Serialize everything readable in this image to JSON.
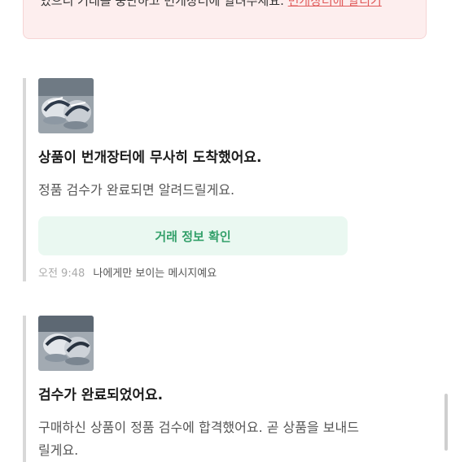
{
  "notice": {
    "text": "있으니 거래를 중단하고 번개장터에 알려주세요.",
    "link_label": "번개장터에 알리기"
  },
  "messages": [
    {
      "title": "상품이 번개장터에 무사히 도착했어요.",
      "body": "정품 검수가 완료되면 알려드릴게요.",
      "button_label": "거래 정보 확인",
      "time": "오전 9:48",
      "note": "나에게만 보이는 메시지예요"
    },
    {
      "title": "검수가 완료되었어요.",
      "body": "구매하신 상품이 정품 검수에 합격했어요. 곧 상품을 보내드릴게요."
    }
  ],
  "colors": {
    "notice_bg": "#fdeeee",
    "link": "#e05a5a",
    "button_bg": "#eaf8f1",
    "button_text": "#33a06a"
  }
}
